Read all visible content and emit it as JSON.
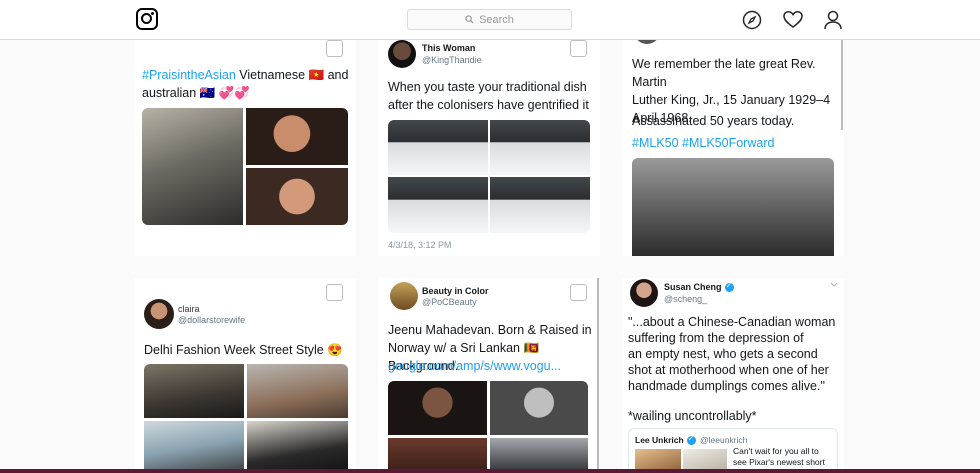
{
  "header": {
    "logo": "instagram-logo",
    "search_placeholder": "Search",
    "icons": [
      "compass-icon",
      "heart-icon",
      "profile-icon"
    ]
  },
  "cards": {
    "praise": {
      "hashtag": "#PraisintheAsian",
      "text_line1_rest": " Vietnamese 🇻🇳 and",
      "text_line2": "australian 🇦🇺 💞💞"
    },
    "colonisers": {
      "user": "This Woman",
      "handle": "@KingThandie",
      "text_line1": "When you taste your traditional dish",
      "text_line2": "after the colonisers have gentrified it",
      "timestamp": "4/3/18, 3:12 PM"
    },
    "mlk": {
      "text_line1": "We remember the late great Rev. Martin",
      "text_line2": "Luther King, Jr., 15 January 1929–4",
      "text_line3": "April 1968.",
      "text_line4": "Assassinated 50 years today.",
      "hashtags": "#MLK50 #MLK50Forward"
    },
    "claira": {
      "user": "claira",
      "handle": "@dollarstorewife",
      "text": "Delhi Fashion Week Street Style 😍"
    },
    "beauty": {
      "user": "Beauty in Color",
      "handle": "@PoCBeauty",
      "text_line1": "Jeenu Mahadevan. Born & Raised in",
      "text_line2": "Norway w/ a Sri Lankan 🇱🇰 Background.",
      "link": "google.com/amp/s/www.vogu..."
    },
    "susan": {
      "user": "Susan Cheng",
      "handle": "@scheng_",
      "text_line1": "\"...about a Chinese-Canadian woman",
      "text_line2": "suffering from the depression of",
      "text_line3": "an empty nest, who gets a second",
      "text_line4": "shot at motherhood when one of her",
      "text_line5": "handmade dumplings comes alive.\"",
      "text_line6": "*wailing uncontrollably*",
      "quote_user": "Lee Unkrich",
      "quote_handle": "@leeunkrich",
      "quote_line1": "Can't wait for you all to",
      "quote_line2": "see Pixar's newest short"
    }
  }
}
